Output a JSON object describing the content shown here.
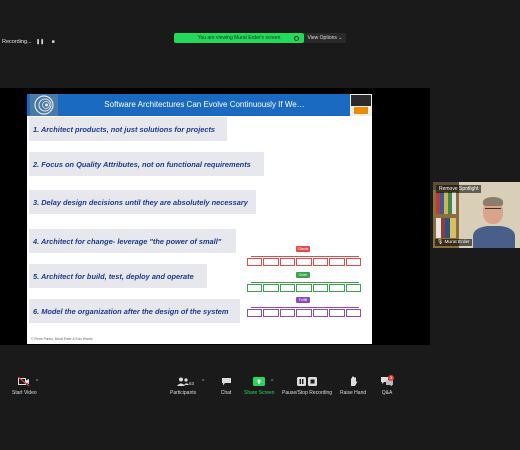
{
  "recording": {
    "label": "Recording..."
  },
  "banner": {
    "viewing_text": "You are viewing Murat Erder's screen",
    "view_options": "View Options"
  },
  "slide": {
    "title": "Software Architectures Can Evolve Continuously If We…",
    "points": [
      "1. Architect products, not just solutions for  projects",
      "2. Focus on Quality Attributes, not on functional requirements",
      "3. Delay design decisions until they are absolutely necessary",
      "4. Architect for change- leverage \"the power of small\"",
      "5. Architect for build, test, deploy and operate",
      "6. Model the organization after the design of the system"
    ],
    "footer": "© Pierre Pureur, Murat Erder & Eoin Woods",
    "diagram": {
      "labels": [
        "Clients",
        "Order",
        "Fulfill"
      ],
      "colors": [
        "#e54a4a",
        "#3aa34a",
        "#8a4ac8"
      ]
    }
  },
  "participant": {
    "name": "Murat Erder",
    "overlay_button": "Remove Spotlight"
  },
  "toolbar": {
    "start_video": "Start Video",
    "participants": "Participants",
    "participants_count": "63",
    "chat": "Chat",
    "share_screen": "Share Screen",
    "pause_recording": "Pause/Stop Recording",
    "raise_hand": "Raise Hand",
    "qa": "Q&A",
    "qa_badge": "3"
  },
  "colors": {
    "accent": "#23d959",
    "slide_header": "#1a6ac2",
    "point_text": "#1f3a8a"
  }
}
